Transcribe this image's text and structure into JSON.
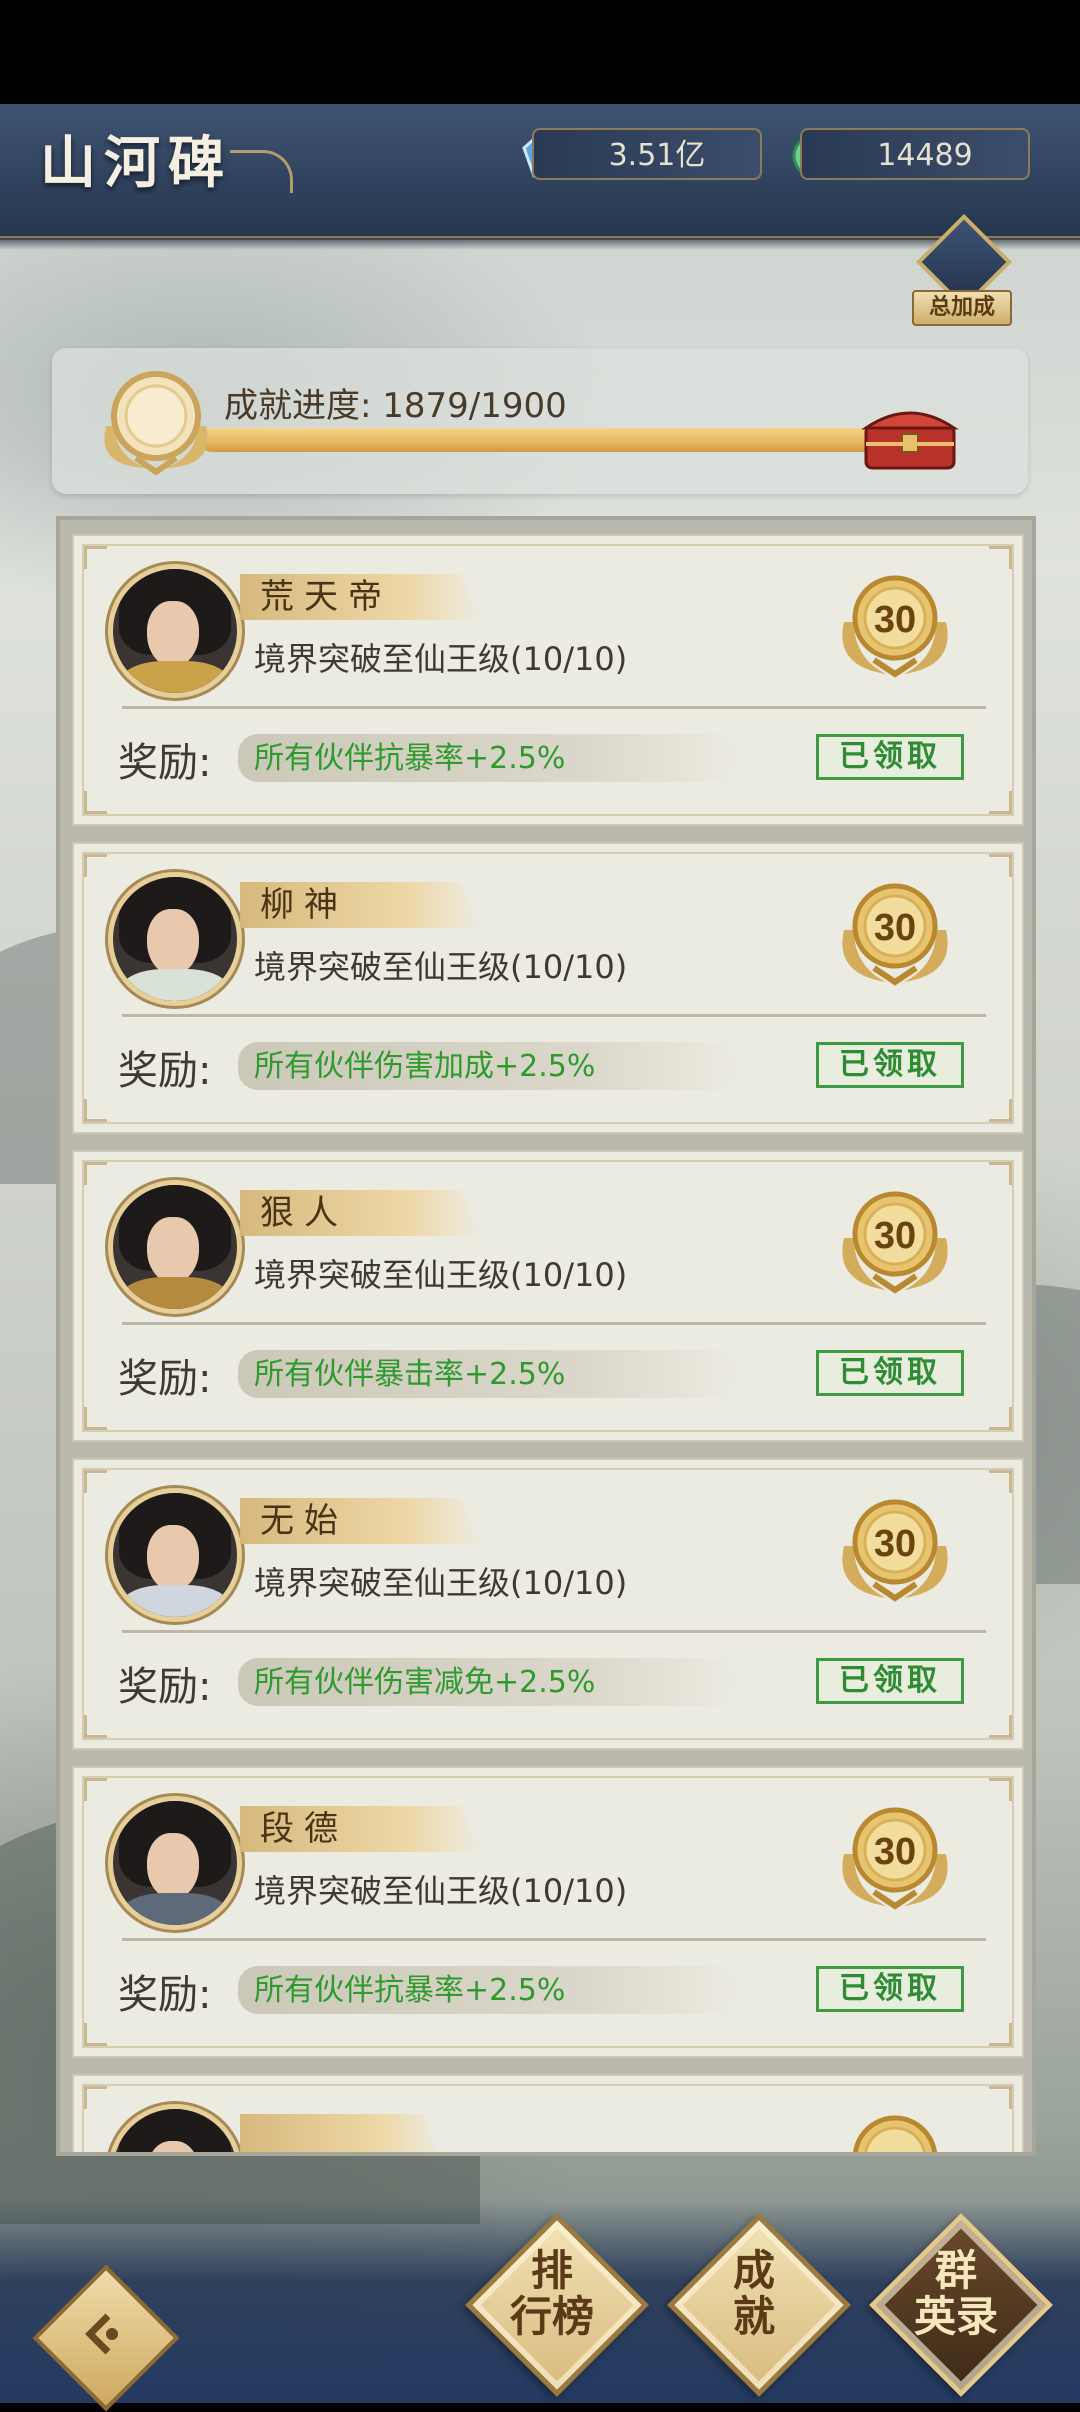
{
  "header": {
    "title": "山河碑"
  },
  "currencies": [
    {
      "icon": "crystal-icon",
      "value": "3.51亿"
    },
    {
      "icon": "jade-coin-icon",
      "value": "14489"
    }
  ],
  "total_bonus": {
    "label": "总加成"
  },
  "progress": {
    "label": "成就进度: 1879/1900",
    "current": 1879,
    "total": 1900
  },
  "cards": [
    {
      "name": "荒天帝",
      "desc": "境界突破至仙王级(10/10)",
      "reward_label": "奖励:",
      "reward": "所有伙伴抗暴率+2.5%",
      "status": "已领取",
      "medal": "30",
      "outfit": "#c9a24a"
    },
    {
      "name": "柳神",
      "desc": "境界突破至仙王级(10/10)",
      "reward_label": "奖励:",
      "reward": "所有伙伴伤害加成+2.5%",
      "status": "已领取",
      "medal": "30",
      "outfit": "#d9e2d6"
    },
    {
      "name": "狠人",
      "desc": "境界突破至仙王级(10/10)",
      "reward_label": "奖励:",
      "reward": "所有伙伴暴击率+2.5%",
      "status": "已领取",
      "medal": "30",
      "outfit": "#b48a3e"
    },
    {
      "name": "无始",
      "desc": "境界突破至仙王级(10/10)",
      "reward_label": "奖励:",
      "reward": "所有伙伴伤害减免+2.5%",
      "status": "已领取",
      "medal": "30",
      "outfit": "#cfd6dd"
    },
    {
      "name": "段德",
      "desc": "境界突破至仙王级(10/10)",
      "reward_label": "奖励:",
      "reward": "所有伙伴抗暴率+2.5%",
      "status": "已领取",
      "medal": "30",
      "outfit": "#5e6a7a"
    },
    {
      "name": "",
      "desc": "",
      "reward_label": "",
      "reward": "",
      "status": "",
      "medal": "",
      "outfit": "#6b3f8a"
    }
  ],
  "nav": [
    {
      "label_line1": "排",
      "label_line2": "行榜",
      "active": false
    },
    {
      "label_line1": "成",
      "label_line2": "就",
      "active": false
    },
    {
      "label_line1": "群",
      "label_line2": "英录",
      "active": true
    }
  ],
  "colors": {
    "header": "#2d3f5a",
    "reward_green": "#2f9a2e",
    "gold": "#d8bb7f"
  }
}
